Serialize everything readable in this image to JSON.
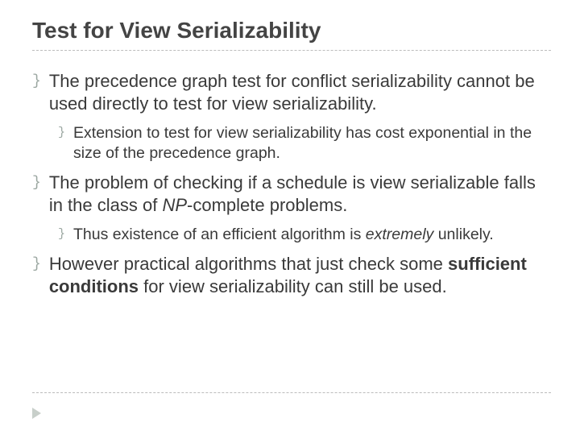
{
  "title": "Test for View Serializability",
  "bullets": {
    "b1": "The precedence graph test for conflict serializability cannot be used directly to test for view serializability.",
    "b1a": "Extension to test for view serializability has cost exponential in the size of the precedence graph.",
    "b2_pre": "The problem of checking if a schedule is view serializable falls in the class of ",
    "b2_em": "NP",
    "b2_post": "-complete problems.",
    "b2a_pre": " Thus existence of an efficient algorithm is ",
    "b2a_em": "extremely",
    "b2a_post": " unlikely.",
    "b3_pre": "However practical algorithms that just check some ",
    "b3_bold": "sufficient conditions",
    "b3_post": " for view serializability can still be used."
  }
}
